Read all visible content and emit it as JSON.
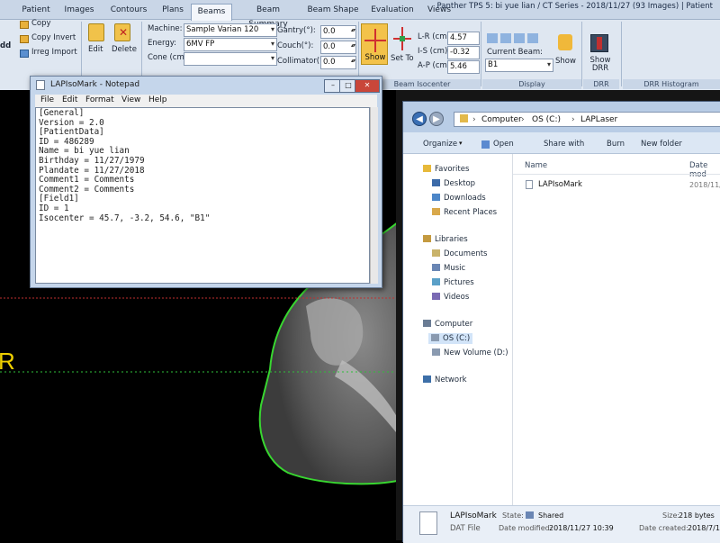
{
  "app": {
    "title": "Panther TPS 5:  bi yue lian  / CT Series - 2018/11/27 (93 Images)  |  Patient"
  },
  "menu_tabs": [
    "Patient",
    "Images",
    "Contours",
    "Plans",
    "Beams",
    "Beam Summary",
    "Beam Shape",
    "Evaluation",
    "Views"
  ],
  "ribbon": {
    "left": {
      "add": "dd",
      "copy": "Copy",
      "copy_invert": "Copy Invert",
      "irreg_import": "Irreg Import"
    },
    "edit": "Edit",
    "delete": "Delete",
    "machine_label": "Machine:",
    "machine_value": "Sample Varian 120",
    "energy_label": "Energy:",
    "energy_value": "6MV FP",
    "cone_label": "Cone (cm):",
    "cone_value": "",
    "gantry_label": "Gantry(°):",
    "gantry_value": "0.0",
    "couch_label": "Couch(°):",
    "couch_value": "0.0",
    "collimator_label": "Collimator(°):",
    "collimator_value": "0.0",
    "show": "Show",
    "set_to": "Set To",
    "lr_label": "L-R (cm):",
    "lr_value": "4.57",
    "is_label": "I-S (cm):",
    "is_value": "-0.32",
    "ap_label": "A-P (cm):",
    "ap_value": "5.46",
    "current_beam_label": "Current Beam:",
    "current_beam_value": "B1",
    "show_drr": "Show DRR",
    "groups": {
      "isocenter": "Beam Isocenter",
      "display": "Display",
      "drr": "DRR",
      "drr_hist": "DRR Histogram"
    }
  },
  "ct": {
    "side_label": "R"
  },
  "notepad": {
    "title": "LAPIsoMark - Notepad",
    "menu": [
      "File",
      "Edit",
      "Format",
      "View",
      "Help"
    ],
    "lines": [
      "[General]",
      "Version = 2.0",
      "[PatientData]",
      "ID = 486289",
      "Name = bi yue lian",
      "Birthday = 11/27/1979",
      "Plandate = 11/27/2018",
      "Comment1 = Comments",
      "Comment2 = Comments",
      "[Field1]",
      "ID = 1",
      "Isocenter = 45.7, -3.2, 54.6, \"B1\""
    ]
  },
  "explorer": {
    "breadcrumb": [
      "Computer",
      "OS (C:)",
      "LAPLaser"
    ],
    "toolbar": [
      "Organize",
      "Open",
      "Share with",
      "Burn",
      "New folder"
    ],
    "nav": {
      "favorites": "Favorites",
      "fav_items": [
        "Desktop",
        "Downloads",
        "Recent Places"
      ],
      "libraries": "Libraries",
      "lib_items": [
        "Documents",
        "Music",
        "Pictures",
        "Videos"
      ],
      "computer": "Computer",
      "comp_items": [
        "OS (C:)",
        "New Volume (D:)"
      ],
      "network": "Network"
    },
    "columns": {
      "name": "Name",
      "date": "Date mod"
    },
    "files": [
      {
        "name": "LAPIsoMark",
        "date": "2018/11/2"
      }
    ],
    "status": {
      "name": "LAPIsoMark",
      "type": "DAT File",
      "state_label": "State:",
      "state_value": "Shared",
      "modified_label": "Date modified:",
      "modified_value": "2018/11/27 10:39",
      "size_label": "Size:",
      "size_value": "218 bytes",
      "created_label": "Date created:",
      "created_value": "2018/7/11"
    }
  },
  "colors": {
    "ribbon_bg": "#dfe7f1",
    "contour": "#38d630",
    "iso_line": "#2fbf3a",
    "marker_red": "#d23a3a",
    "label_yellow": "#f0d000"
  }
}
